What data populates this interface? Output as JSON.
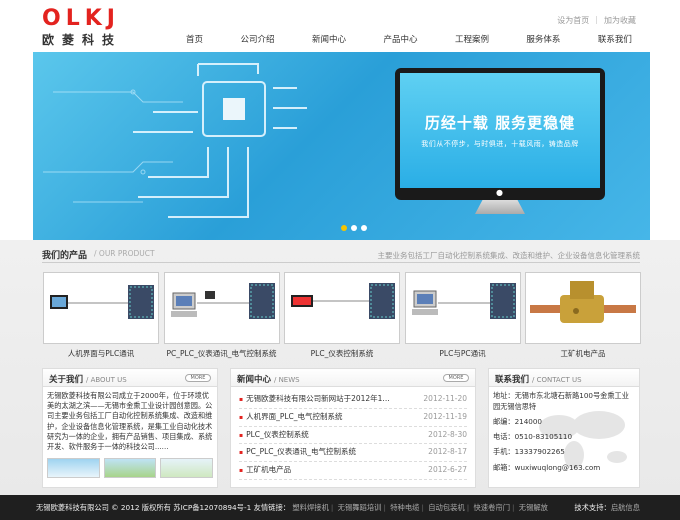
{
  "brand": {
    "logo_letters": [
      "O",
      "L",
      "K",
      "J"
    ],
    "name_cn": "欧菱科技",
    "color": "#e3231f"
  },
  "toplinks": [
    "设为首页",
    "加为收藏"
  ],
  "nav": [
    "首页",
    "公司介绍",
    "新闻中心",
    "产品中心",
    "工程案例",
    "服务体系",
    "联系我们"
  ],
  "banner": {
    "slogan": "历经十载  服务更稳健",
    "sub": "我们从不停步，与时俱进，十载风雨，铸造品牌",
    "apple_icon": "apple-logo-icon",
    "slides": 3,
    "active_slide": 1
  },
  "products": {
    "title": "我们的产品",
    "title_en": "/ OUR PRODUCT",
    "desc": "主要业务包括工厂自动化控制系统集成、改造和维护、企业设备信息化管理系统",
    "items": [
      {
        "label": "人机界面与PLC通讯"
      },
      {
        "label": "PC_PLC_仪表通讯_电气控制系统"
      },
      {
        "label": "PLC_仪表控制系统"
      },
      {
        "label": "PLC与PC通讯"
      },
      {
        "label": "工矿机电产品"
      }
    ]
  },
  "about": {
    "title": "关于我们",
    "title_en": "/ ABOUT US",
    "more": "MORE",
    "text": "无锡欧菱科技有限公司成立于2000年，位于环境优美的太湖之滨——无锡市金熏工业设计园创意园。公司主要业务包括工厂自动化控制系统集成、改造和维护，企业设备信息化管理系统，是集工业自动化技术研究为一体的企业，拥有产品销售、项目集成、系统开发、软件服务于一体的科技公司......"
  },
  "news": {
    "title": "新闻中心",
    "title_en": "/ NEWS",
    "more": "MORE",
    "items": [
      {
        "title": "无锡欧菱科技有限公司新网站于2012年1...",
        "date": "2012-11-20"
      },
      {
        "title": "人机界面_PLC_电气控制系统",
        "date": "2012-11-19"
      },
      {
        "title": "PLC_仪表控制系统",
        "date": "2012-8-30"
      },
      {
        "title": "PC_PLC_仪表通讯_电气控制系统",
        "date": "2012-8-17"
      },
      {
        "title": "工矿机电产品",
        "date": "2012-6-27"
      }
    ]
  },
  "contact": {
    "title": "联系我们",
    "title_en": "/ CONTACT US",
    "address": "地址：无锡市东北塘石新路100号金熏工业园无锡信思特",
    "zip": "邮编：214000",
    "phone": "电话：0510-83105110",
    "mobile": "手机：13337902265",
    "email": "邮箱：wuxiwuqlong@163.com"
  },
  "footer": {
    "copyright": "无锡欧菱科技有限公司 © 2012 版权所有 苏ICP备12070894号-1 友情链接：",
    "links": [
      "塑料焊接机",
      "无锡舞蹈培训",
      "特种电缆",
      "自动包装机",
      "快速卷帘门",
      "无锡解放"
    ],
    "tech_label": "技术支持：",
    "tech_link": "启航信息"
  }
}
